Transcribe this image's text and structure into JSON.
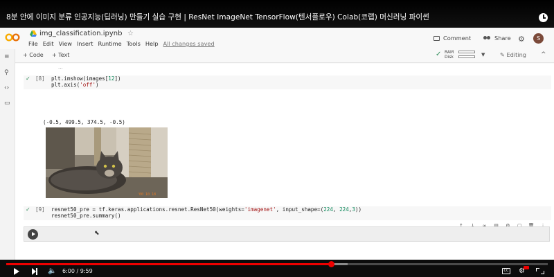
{
  "video": {
    "title": "8분 안에 이미지 분류 인공지능(딥러닝) 만들기 실습 구현 | ResNet ImageNet TensorFlow(텐서플로우) Colab(코랩) 머신러닝 파이썬",
    "current_time": "6:00",
    "duration": "9:59",
    "time_display": "6:00 / 9:59",
    "played_fraction": 0.6,
    "buffered_fraction": 0.63,
    "accent_color": "#ee0000"
  },
  "colab": {
    "notebook_title": "img_classification.ipynb",
    "menu": [
      "File",
      "Edit",
      "View",
      "Insert",
      "Runtime",
      "Tools",
      "Help"
    ],
    "save_status": "All changes saved",
    "comment_label": "Comment",
    "share_label": "Share",
    "avatar_letter": "S",
    "add_code_label": "+ Code",
    "add_text_label": "+ Text",
    "ram_label": "RAM",
    "disk_label": "Disk",
    "editing_label": "Editing",
    "scroll_tail": "  ..."
  },
  "cells": [
    {
      "exec_count": "[8]",
      "line1_fn": "plt.imshow(images[",
      "line1_num": "12",
      "line1_end": "])",
      "line2_fn": "plt.axis(",
      "line2_str": "'off'",
      "line2_end": ")",
      "output": "(-0.5, 499.5, 374.5, -0.5)"
    },
    {
      "exec_count": "[9]",
      "line1_a": "resnet50_pre = tf.keras.applications.resnet.ResNet50(weights=",
      "line1_str": "'imagenet'",
      "line1_b": ", input_shape=(",
      "line1_n1": "224",
      "line1_c": ", ",
      "line1_n2": "224",
      "line1_d": ",",
      "line1_n3": "3",
      "line1_e": "))",
      "line2": "resnet50_pre.summary()"
    }
  ],
  "image": {
    "timestamp_text": "'00 10 18"
  }
}
